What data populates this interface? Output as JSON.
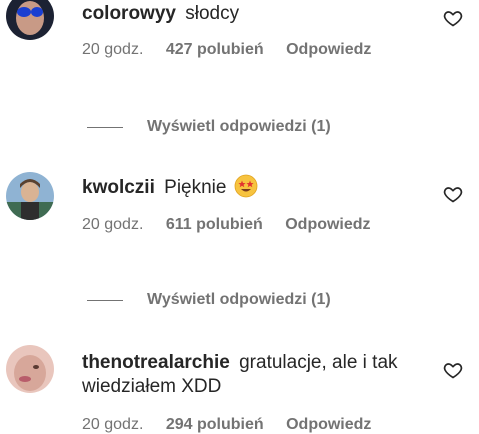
{
  "comments": [
    {
      "username": "colorowyy",
      "text": "słodcy",
      "time": "20 godz.",
      "likes": "427 polubień",
      "reply": "Odpowiedz",
      "view_replies": "Wyświetl odpowiedzi (1)",
      "avatar_color": "#2b3550"
    },
    {
      "username": "kwolczii",
      "text": "Pięknie",
      "emoji": "star-struck-emoji",
      "time": "20 godz.",
      "likes": "611 polubień",
      "reply": "Odpowiedz",
      "view_replies": "Wyświetl odpowiedzi (1)",
      "avatar_color": "#6a8fb0"
    },
    {
      "username": "thenotrealarchie",
      "text": "gratulacje, ale i tak wiedziałem XDD",
      "time": "20 godz.",
      "likes": "294 polubień",
      "reply": "Odpowiedz",
      "avatar_color": "#c9998f"
    }
  ],
  "icons": {
    "like": "heart-outline-icon"
  }
}
